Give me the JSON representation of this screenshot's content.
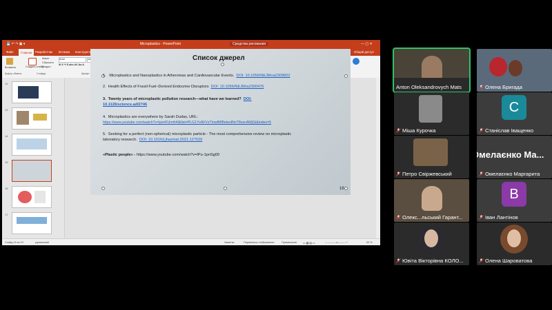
{
  "ppt": {
    "title": "Microplastics - PowerPoint",
    "tool_tab": "Средства рисования",
    "tabs": [
      "Файл",
      "Главная",
      "Разработчик",
      "Вставка",
      "Конструктор",
      "Переходы",
      "Анимация",
      "Слайд-шоу",
      "Рецензирование",
      "Вид",
      "Справка",
      "Формат"
    ],
    "search": "Что вы хотите сделать?",
    "share": "Общий доступ",
    "ribbon_groups": [
      "Буфер обмена",
      "Слайды",
      "Шрифт",
      "Абзац",
      "Рисование",
      "Редактирование",
      "Голос"
    ],
    "ribbon_items": {
      "paste": "Вставить",
      "new_slide": "Создать слайд",
      "layout": "Макет",
      "reset": "Сбросить",
      "section": "Раздел",
      "font": "Arial",
      "font_size": "18",
      "text_direction": "Направление текста",
      "align_text": "Выровнять текст",
      "smartart": "Преобразовать в SmartArt",
      "arrange": "Упорядочить",
      "quick_styles": "Экспресс-стили",
      "fill": "Заливка фигуры",
      "outline": "Контур фигуры",
      "effects": "Эффекты фигуры",
      "find": "Найти",
      "replace": "Заменить",
      "select": "Выделить",
      "dictate": "Диктовать"
    },
    "slide_numbers": [
      "12",
      "13",
      "14",
      "15",
      "16",
      "17"
    ],
    "slide": {
      "title": "Список джерел",
      "items": [
        {
          "num": "1.",
          "text": "Microplastics and Nanoplastics in Atheromas and Cardiovascular Events.",
          "doi": "DOI: 10.1056/NEJMoa2309822"
        },
        {
          "num": "2.",
          "text": "Health Effects of Fossil Fuel–Derived Endocrine Disruptors",
          "doi": "DOI: 10.1056/NEJMra2300476"
        },
        {
          "num": "3.",
          "text": "Twenty years of microplastic pollution research—what have we learned?",
          "doi": "DOI:",
          "doi2": "10.1126/science.adl2746"
        },
        {
          "num": "4.",
          "text": "Microplastics are everywhere by Sarah Dudas, URL:",
          "url": "https://www.youtube.com/watch?v=ijsmFUmih4I&list=PLG1YvAVVzTInwfMf8ekedNnT8oscAWjGi&index=5"
        },
        {
          "num": "5.",
          "text": "Seeking for a perfect (non-spherical) microplastic particle - The most comprehensive review on microplastic",
          "text2": "laboratory research.",
          "doi": "DOI: 10.1016/j.jhazmat.2021.127529"
        }
      ],
      "video_label": "«Plastic people»",
      "video_sep": " - ",
      "video_url": "https://www.youtube.com/watch?v=IPu-1pnSg00",
      "page_number": "16"
    },
    "status": {
      "slide": "Слайд 16 из 19",
      "lang": "украинский",
      "notes": "Заметки",
      "comments": "Параметры отображения",
      "view": "Примечания",
      "zoom": "63 %"
    }
  },
  "participants": [
    {
      "name": "Anton Oleksandrovych Mats",
      "muted": false
    },
    {
      "name": "Олена Бригада",
      "muted": true
    },
    {
      "name": "Міша Курочка",
      "muted": true
    },
    {
      "name": "Станіслав Іващенко",
      "muted": true,
      "initial": "С",
      "color": "#1a8a9a"
    },
    {
      "name": "Петро Свіржевський",
      "muted": true
    },
    {
      "name": "Омелаєнко Маргарита",
      "muted": true,
      "big": "Омелаєнко  Ма..."
    },
    {
      "name": "Олекс...льський Гарант...",
      "muted": true
    },
    {
      "name": "Іван Лантінов",
      "muted": true,
      "initial": "В",
      "color": "#8b3aa8"
    },
    {
      "name": "Ювіта Вікторівна КОЛО...",
      "muted": true
    },
    {
      "name": "Олена Шароватова",
      "muted": true
    }
  ]
}
